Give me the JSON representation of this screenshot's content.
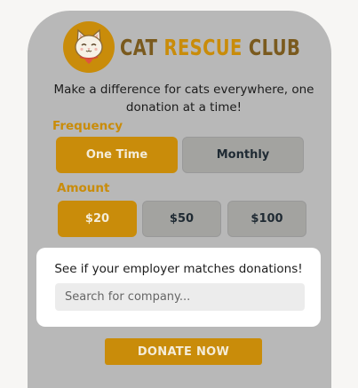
{
  "brand": {
    "word1": "CAT",
    "word2": "RESCUE",
    "word3": "CLUB",
    "logo_icon": "cat-face-icon"
  },
  "tagline": "Make a difference for cats everywhere, one donation at a time!",
  "frequency": {
    "label": "Frequency",
    "options": [
      {
        "label": "One Time",
        "selected": true
      },
      {
        "label": "Monthly",
        "selected": false
      }
    ]
  },
  "amount": {
    "label": "Amount",
    "options": [
      {
        "label": "$20",
        "selected": true
      },
      {
        "label": "$50",
        "selected": false
      },
      {
        "label": "$100",
        "selected": false
      }
    ]
  },
  "employer_match": {
    "text": "See if your employer matches donations!",
    "search_placeholder": "Search for company..."
  },
  "donate_label": "DONATE NOW",
  "colors": {
    "accent": "#c98c0a",
    "card_bg": "#b8b8b8",
    "unselected_bg": "#a3a3a0"
  }
}
